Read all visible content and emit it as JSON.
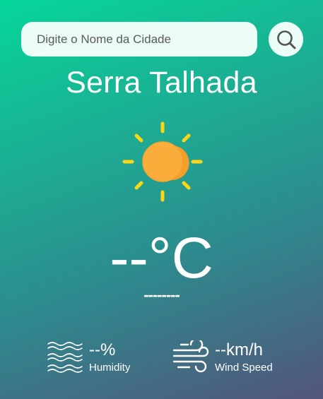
{
  "search": {
    "placeholder": "Digite o Nome da Cidade",
    "button_icon": "search-icon"
  },
  "weather": {
    "city": "Serra Talhada",
    "icon": "sun-icon",
    "temperature": "--°C",
    "description": "--------"
  },
  "details": {
    "humidity": {
      "icon": "waves-icon",
      "value": "--%",
      "label": "Humidity"
    },
    "wind": {
      "icon": "wind-icon",
      "value": "--km/h",
      "label": "Wind Speed"
    }
  },
  "colors": {
    "gradient_start": "#06d69a",
    "gradient_end": "#53557a",
    "input_bg": "#ecfdf8",
    "sun_rays": "#f9d616",
    "sun_core": "#fbad3b"
  }
}
